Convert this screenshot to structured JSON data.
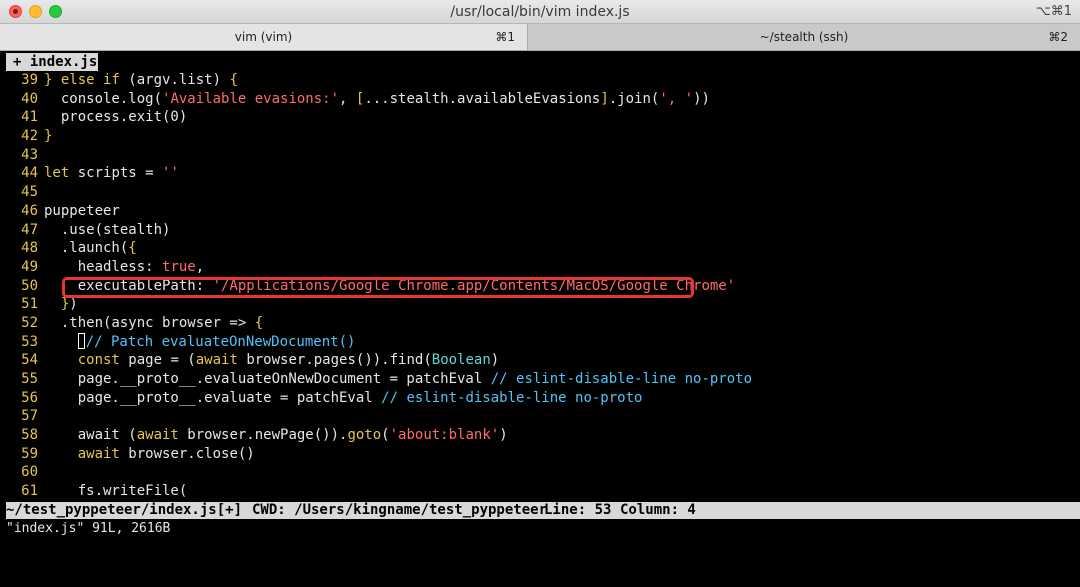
{
  "window": {
    "title": "/usr/local/bin/vim index.js",
    "shortcut": "⌥⌘1"
  },
  "tabs": [
    {
      "label": "vim (vim)",
      "key": "⌘1"
    },
    {
      "label": "~/stealth (ssh)",
      "key": "⌘2"
    }
  ],
  "vim_tab": {
    "label": "+ index.js"
  },
  "code": {
    "lines": [
      {
        "n": "39"
      },
      {
        "n": "40"
      },
      {
        "n": "41"
      },
      {
        "n": "42"
      },
      {
        "n": "43"
      },
      {
        "n": "44"
      },
      {
        "n": "45"
      },
      {
        "n": "46"
      },
      {
        "n": "47"
      },
      {
        "n": "48"
      },
      {
        "n": "49"
      },
      {
        "n": "50"
      },
      {
        "n": "51"
      },
      {
        "n": "52"
      },
      {
        "n": "53"
      },
      {
        "n": "54"
      },
      {
        "n": "55"
      },
      {
        "n": "56"
      },
      {
        "n": "57"
      },
      {
        "n": "58"
      },
      {
        "n": "59"
      },
      {
        "n": "60"
      },
      {
        "n": "61"
      }
    ],
    "l39": {
      "a": "} ",
      "b": "else if",
      "c": " (argv.list) ",
      "d": "{"
    },
    "l40": {
      "a": "  console.log(",
      "b": "'Available evasions:'",
      "c": ", ",
      "d": "[",
      "e": "...stealth.availableEvasions",
      "f": "]",
      "g": ".join(",
      "h": "', '",
      "i": "))"
    },
    "l41": {
      "a": "  process.exit(0)"
    },
    "l42": {
      "a": "}"
    },
    "l44": {
      "a": "let",
      "b": " scripts = ",
      "c": "''"
    },
    "l46": {
      "a": "puppeteer"
    },
    "l47": {
      "a": "  .use(stealth)"
    },
    "l48": {
      "a": "  .launch(",
      "b": "{"
    },
    "l49": {
      "a": "    headless: ",
      "b": "true",
      "c": ","
    },
    "l50": {
      "a": "    executablePath: ",
      "b": "'/Applications/Google Chrome.app/Contents/MacOS/Google Chrome'"
    },
    "l51": {
      "a": "  ",
      "b": "}",
      "c": ")"
    },
    "l52": {
      "a": "  .then(async browser => ",
      "b": "{"
    },
    "l53": {
      "a": "    ",
      "b": "// Patch evaluateOnNewDocument()"
    },
    "l54": {
      "a": "    ",
      "b": "const",
      "c": " page = (",
      "d": "await",
      "e": " browser.pages()).find(",
      "f": "Boolean",
      "g": ")"
    },
    "l55": {
      "a": "    page.__proto__.evaluateOnNewDocument = patchEval ",
      "b": "// eslint-disable-line no-proto"
    },
    "l56": {
      "a": "    page.__proto__.evaluate = patchEval ",
      "b": "// eslint-disable-line no-proto"
    },
    "l58": {
      "a": "    await (",
      "b": "await",
      "c": " browser.newPage()).",
      "d": "goto",
      "e": "(",
      "f": "'about:blank'",
      "g": ")"
    },
    "l59": {
      "a": "    ",
      "b": "await",
      "c": " browser.close()"
    },
    "l61": {
      "a": "    fs.writeFile("
    }
  },
  "status": {
    "file": "~/test_pyppeteer/index.js[+]",
    "cwd": "CWD: /Users/kingname/test_pyppeteer",
    "line": "Line: 53",
    "column": "Column: 4"
  },
  "cmdline": {
    "text": "\"index.js\" 91L, 2616B"
  },
  "colors": {
    "keyword": "#e5c64a",
    "string": "#ff6b6b",
    "comment": "#4fc3f7",
    "highlight_box": "#e8362c"
  }
}
